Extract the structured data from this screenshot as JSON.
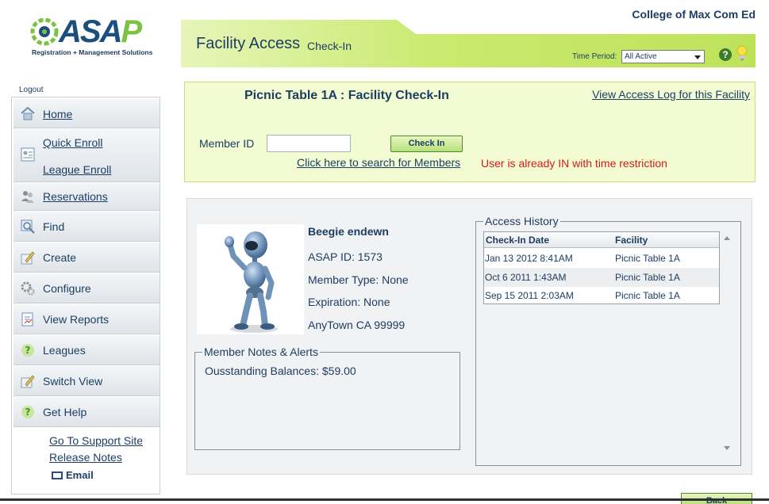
{
  "brand": {
    "logo_text_main": "ASA",
    "logo_text_accent": "P",
    "tagline": "Registration + Management Solutions",
    "college": "College of Max Com Ed"
  },
  "header": {
    "title": "Facility Access",
    "subtitle": "Check-In",
    "time_period_label": "Time Period:",
    "time_period_value": "All Active"
  },
  "sidebar": {
    "logout": "Logout",
    "items": [
      {
        "label": "Home"
      },
      {
        "label": "Quick Enroll"
      },
      {
        "label": "League Enroll"
      },
      {
        "label": "Reservations"
      },
      {
        "label": "Find"
      },
      {
        "label": "Create"
      },
      {
        "label": "Configure"
      },
      {
        "label": "View Reports"
      },
      {
        "label": "Leagues"
      },
      {
        "label": "Switch View"
      },
      {
        "label": "Get Help"
      }
    ],
    "help_links": {
      "support": "Go To Support Site",
      "release_notes": "Release Notes",
      "email": "Email"
    }
  },
  "checkin": {
    "title": "Picnic Table 1A : Facility Check-In",
    "access_log_link": "View Access Log for this Facility",
    "member_id_label": "Member ID",
    "member_id_value": "",
    "button_label": "Check In",
    "search_link": "Click here to search for Members",
    "status_message": "User is already IN with time restriction"
  },
  "member": {
    "name": "Beegie endewn",
    "asap_id": "ASAP ID: 1573",
    "member_type": "Member Type: None",
    "expiration": "Expiration: None",
    "location": "AnyTown CA 99999",
    "notes_legend": "Member Notes & Alerts",
    "notes_text": "Ousstanding Balances: $59.00"
  },
  "access_history": {
    "legend": "Access History",
    "columns": [
      "Check-In Date",
      "Facility"
    ],
    "rows": [
      [
        "Jan 13 2012 8:41AM",
        "Picnic Table 1A"
      ],
      [
        "Oct 6 2011 1:43AM",
        "Picnic Table 1A"
      ],
      [
        "Sep 15 2011 2:03AM",
        "Picnic Table 1A"
      ]
    ]
  },
  "footer": {
    "back_label": "Back"
  },
  "colors": {
    "header_green": "#c3e66a",
    "panel_green": "#f3fbd2",
    "text_navy": "#1d3d63",
    "status_red": "#d51a1a"
  }
}
